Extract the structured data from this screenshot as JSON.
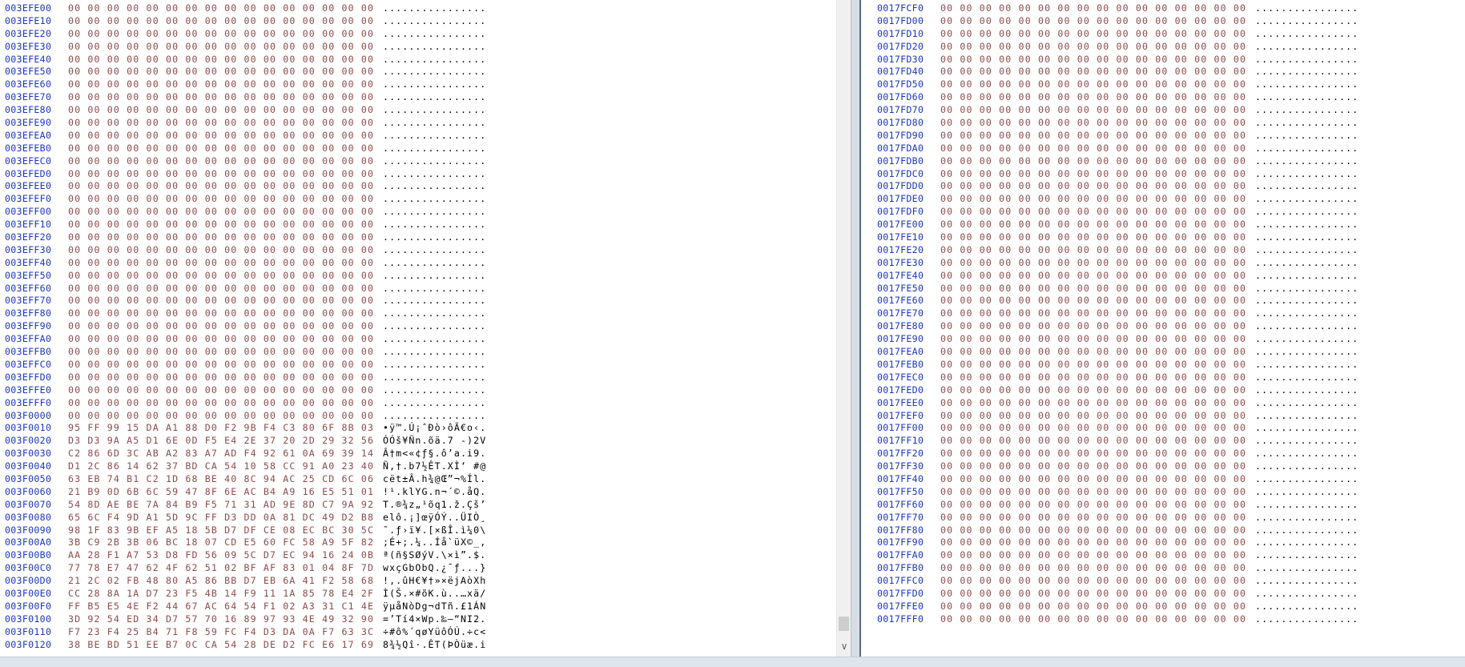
{
  "left_pane": {
    "rows": [
      {
        "offset": "003EFE00",
        "hex": "00 00 00 00 00 00 00 00 00 00 00 00 00 00 00 00",
        "ascii": "................"
      },
      {
        "offset": "003EFE10",
        "hex": "00 00 00 00 00 00 00 00 00 00 00 00 00 00 00 00",
        "ascii": "................"
      },
      {
        "offset": "003EFE20",
        "hex": "00 00 00 00 00 00 00 00 00 00 00 00 00 00 00 00",
        "ascii": "................"
      },
      {
        "offset": "003EFE30",
        "hex": "00 00 00 00 00 00 00 00 00 00 00 00 00 00 00 00",
        "ascii": "................"
      },
      {
        "offset": "003EFE40",
        "hex": "00 00 00 00 00 00 00 00 00 00 00 00 00 00 00 00",
        "ascii": "................"
      },
      {
        "offset": "003EFE50",
        "hex": "00 00 00 00 00 00 00 00 00 00 00 00 00 00 00 00",
        "ascii": "................"
      },
      {
        "offset": "003EFE60",
        "hex": "00 00 00 00 00 00 00 00 00 00 00 00 00 00 00 00",
        "ascii": "................"
      },
      {
        "offset": "003EFE70",
        "hex": "00 00 00 00 00 00 00 00 00 00 00 00 00 00 00 00",
        "ascii": "................"
      },
      {
        "offset": "003EFE80",
        "hex": "00 00 00 00 00 00 00 00 00 00 00 00 00 00 00 00",
        "ascii": "................"
      },
      {
        "offset": "003EFE90",
        "hex": "00 00 00 00 00 00 00 00 00 00 00 00 00 00 00 00",
        "ascii": "................"
      },
      {
        "offset": "003EFEA0",
        "hex": "00 00 00 00 00 00 00 00 00 00 00 00 00 00 00 00",
        "ascii": "................"
      },
      {
        "offset": "003EFEB0",
        "hex": "00 00 00 00 00 00 00 00 00 00 00 00 00 00 00 00",
        "ascii": "................"
      },
      {
        "offset": "003EFEC0",
        "hex": "00 00 00 00 00 00 00 00 00 00 00 00 00 00 00 00",
        "ascii": "................"
      },
      {
        "offset": "003EFED0",
        "hex": "00 00 00 00 00 00 00 00 00 00 00 00 00 00 00 00",
        "ascii": "................"
      },
      {
        "offset": "003EFEE0",
        "hex": "00 00 00 00 00 00 00 00 00 00 00 00 00 00 00 00",
        "ascii": "................"
      },
      {
        "offset": "003EFEF0",
        "hex": "00 00 00 00 00 00 00 00 00 00 00 00 00 00 00 00",
        "ascii": "................"
      },
      {
        "offset": "003EFF00",
        "hex": "00 00 00 00 00 00 00 00 00 00 00 00 00 00 00 00",
        "ascii": "................"
      },
      {
        "offset": "003EFF10",
        "hex": "00 00 00 00 00 00 00 00 00 00 00 00 00 00 00 00",
        "ascii": "................"
      },
      {
        "offset": "003EFF20",
        "hex": "00 00 00 00 00 00 00 00 00 00 00 00 00 00 00 00",
        "ascii": "................"
      },
      {
        "offset": "003EFF30",
        "hex": "00 00 00 00 00 00 00 00 00 00 00 00 00 00 00 00",
        "ascii": "................"
      },
      {
        "offset": "003EFF40",
        "hex": "00 00 00 00 00 00 00 00 00 00 00 00 00 00 00 00",
        "ascii": "................"
      },
      {
        "offset": "003EFF50",
        "hex": "00 00 00 00 00 00 00 00 00 00 00 00 00 00 00 00",
        "ascii": "................"
      },
      {
        "offset": "003EFF60",
        "hex": "00 00 00 00 00 00 00 00 00 00 00 00 00 00 00 00",
        "ascii": "................"
      },
      {
        "offset": "003EFF70",
        "hex": "00 00 00 00 00 00 00 00 00 00 00 00 00 00 00 00",
        "ascii": "................"
      },
      {
        "offset": "003EFF80",
        "hex": "00 00 00 00 00 00 00 00 00 00 00 00 00 00 00 00",
        "ascii": "................"
      },
      {
        "offset": "003EFF90",
        "hex": "00 00 00 00 00 00 00 00 00 00 00 00 00 00 00 00",
        "ascii": "................"
      },
      {
        "offset": "003EFFA0",
        "hex": "00 00 00 00 00 00 00 00 00 00 00 00 00 00 00 00",
        "ascii": "................"
      },
      {
        "offset": "003EFFB0",
        "hex": "00 00 00 00 00 00 00 00 00 00 00 00 00 00 00 00",
        "ascii": "................"
      },
      {
        "offset": "003EFFC0",
        "hex": "00 00 00 00 00 00 00 00 00 00 00 00 00 00 00 00",
        "ascii": "................"
      },
      {
        "offset": "003EFFD0",
        "hex": "00 00 00 00 00 00 00 00 00 00 00 00 00 00 00 00",
        "ascii": "................"
      },
      {
        "offset": "003EFFE0",
        "hex": "00 00 00 00 00 00 00 00 00 00 00 00 00 00 00 00",
        "ascii": "................"
      },
      {
        "offset": "003EFFF0",
        "hex": "00 00 00 00 00 00 00 00 00 00 00 00 00 00 00 00",
        "ascii": "................"
      },
      {
        "offset": "003F0000",
        "hex": "00 00 00 00 00 00 00 00 00 00 00 00 00 00 00 00",
        "ascii": "................"
      },
      {
        "offset": "003F0010",
        "hex": "95 FF 99 15 DA A1 88 D0 F2 9B F4 C3 80 6F 8B 03",
        "ascii": "•ÿ™.Ú¡ˆÐò›ôÃ€o‹."
      },
      {
        "offset": "003F0020",
        "hex": "D3 D3 9A A5 D1 6E 0D F5 E4 2E 37 20 2D 29 32 56",
        "ascii": "ÓÓš¥Ñn.õä.7 -)2V"
      },
      {
        "offset": "003F0030",
        "hex": "C2 86 6D 3C AB A2 83 A7 AD F4 92 61 0A 69 39 14",
        "ascii": "Â†m<«¢ƒ§.ô’a.i9."
      },
      {
        "offset": "003F0040",
        "hex": "D1 2C 86 14 62 37 BD CA 54 10 58 CC 91 A0 23 40",
        "ascii": "Ñ,†.b7½ÊT.XÌ‘ #@"
      },
      {
        "offset": "003F0050",
        "hex": "63 EB 74 B1 C2 1D 68 BE 40 8C 94 AC 25 CD 6C 06",
        "ascii": "cët±Â.h¾@Œ”¬%Íl."
      },
      {
        "offset": "003F0060",
        "hex": "21 B9 0D 6B 6C 59 47 8F 6E AC B4 A9 16 E5 51 01",
        "ascii": "!¹.klYG.n¬´©.åQ."
      },
      {
        "offset": "003F0070",
        "hex": "54 8D AE BE 7A 84 B9 F5 71 31 AD 9E 8D C7 9A 92",
        "ascii": "T.®¾z„¹õq1.ž.Çš’"
      },
      {
        "offset": "003F0080",
        "hex": "65 6C F4 9D A1 5D 9C FF D3 DD 0A 81 DC 49 D2 B8",
        "ascii": "elô.¡]œÿÓÝ..ÜIÒ¸"
      },
      {
        "offset": "003F0090",
        "hex": "98 1F 83 9B EF A5 18 5B D7 DF CE 08 EC BC 30 5C",
        "ascii": "˜.ƒ›ï¥.[×ßÎ.ì¼0\\"
      },
      {
        "offset": "003F00A0",
        "hex": "3B C9 2B 3B 06 BC 18 07 CD E5 60 FC 58 A9 5F 82",
        "ascii": ";É+;.¼..Íå`üX©_‚"
      },
      {
        "offset": "003F00B0",
        "hex": "AA 28 F1 A7 53 D8 FD 56 09 5C D7 EC 94 16 24 0B",
        "ascii": "ª(ñ§SØýV.\\×ì”.$."
      },
      {
        "offset": "003F00C0",
        "hex": "77 78 E7 47 62 4F 62 51 02 BF AF 83 01 04 8F 7D",
        "ascii": "wxçGbObQ.¿¯ƒ...}"
      },
      {
        "offset": "003F00D0",
        "hex": "21 2C 02 FB 48 80 A5 86 BB D7 EB 6A 41 F2 58 68",
        "ascii": "!,.ûH€¥†»×ëjAòXh"
      },
      {
        "offset": "003F00E0",
        "hex": "CC 28 8A 1A D7 23 F5 4B 14 F9 11 1A 85 78 E4 2F",
        "ascii": "Ì(Š.×#õK.ù..…xä/"
      },
      {
        "offset": "003F00F0",
        "hex": "FF B5 E5 4E F2 44 67 AC 64 54 F1 02 A3 31 C1 4E",
        "ascii": "ÿµåNòDg¬dTñ.£1ÁN"
      },
      {
        "offset": "003F0100",
        "hex": "3D 92 54 ED 34 D7 57 70 16 89 97 93 4E 49 32 90",
        "ascii": "=’Tí4×Wp.‰—“NI2."
      },
      {
        "offset": "003F0110",
        "hex": "F7 23 F4 25 B4 71 F8 59 FC F4 D3 DA 0A F7 63 3C",
        "ascii": "÷#ô%´qøYüôÓÚ.÷c<"
      },
      {
        "offset": "003F0120",
        "hex": "38 BE BD 51 EE B7 0C CA 54 28 DE D2 FC E6 17 69",
        "ascii": "8¾½Qî·.ÊT(ÞÒüæ.i"
      }
    ]
  },
  "right_pane": {
    "rows": [
      {
        "offset": "0017FCF0",
        "hex": "00 00 00 00 00 00 00 00 00 00 00 00 00 00 00 00",
        "ascii": "................"
      },
      {
        "offset": "0017FD00",
        "hex": "00 00 00 00 00 00 00 00 00 00 00 00 00 00 00 00",
        "ascii": "................"
      },
      {
        "offset": "0017FD10",
        "hex": "00 00 00 00 00 00 00 00 00 00 00 00 00 00 00 00",
        "ascii": "................"
      },
      {
        "offset": "0017FD20",
        "hex": "00 00 00 00 00 00 00 00 00 00 00 00 00 00 00 00",
        "ascii": "................"
      },
      {
        "offset": "0017FD30",
        "hex": "00 00 00 00 00 00 00 00 00 00 00 00 00 00 00 00",
        "ascii": "................"
      },
      {
        "offset": "0017FD40",
        "hex": "00 00 00 00 00 00 00 00 00 00 00 00 00 00 00 00",
        "ascii": "................"
      },
      {
        "offset": "0017FD50",
        "hex": "00 00 00 00 00 00 00 00 00 00 00 00 00 00 00 00",
        "ascii": "................"
      },
      {
        "offset": "0017FD60",
        "hex": "00 00 00 00 00 00 00 00 00 00 00 00 00 00 00 00",
        "ascii": "................"
      },
      {
        "offset": "0017FD70",
        "hex": "00 00 00 00 00 00 00 00 00 00 00 00 00 00 00 00",
        "ascii": "................"
      },
      {
        "offset": "0017FD80",
        "hex": "00 00 00 00 00 00 00 00 00 00 00 00 00 00 00 00",
        "ascii": "................"
      },
      {
        "offset": "0017FD90",
        "hex": "00 00 00 00 00 00 00 00 00 00 00 00 00 00 00 00",
        "ascii": "................"
      },
      {
        "offset": "0017FDA0",
        "hex": "00 00 00 00 00 00 00 00 00 00 00 00 00 00 00 00",
        "ascii": "................"
      },
      {
        "offset": "0017FDB0",
        "hex": "00 00 00 00 00 00 00 00 00 00 00 00 00 00 00 00",
        "ascii": "................"
      },
      {
        "offset": "0017FDC0",
        "hex": "00 00 00 00 00 00 00 00 00 00 00 00 00 00 00 00",
        "ascii": "................"
      },
      {
        "offset": "0017FDD0",
        "hex": "00 00 00 00 00 00 00 00 00 00 00 00 00 00 00 00",
        "ascii": "................"
      },
      {
        "offset": "0017FDE0",
        "hex": "00 00 00 00 00 00 00 00 00 00 00 00 00 00 00 00",
        "ascii": "................"
      },
      {
        "offset": "0017FDF0",
        "hex": "00 00 00 00 00 00 00 00 00 00 00 00 00 00 00 00",
        "ascii": "................"
      },
      {
        "offset": "0017FE00",
        "hex": "00 00 00 00 00 00 00 00 00 00 00 00 00 00 00 00",
        "ascii": "................"
      },
      {
        "offset": "0017FE10",
        "hex": "00 00 00 00 00 00 00 00 00 00 00 00 00 00 00 00",
        "ascii": "................"
      },
      {
        "offset": "0017FE20",
        "hex": "00 00 00 00 00 00 00 00 00 00 00 00 00 00 00 00",
        "ascii": "................"
      },
      {
        "offset": "0017FE30",
        "hex": "00 00 00 00 00 00 00 00 00 00 00 00 00 00 00 00",
        "ascii": "................"
      },
      {
        "offset": "0017FE40",
        "hex": "00 00 00 00 00 00 00 00 00 00 00 00 00 00 00 00",
        "ascii": "................"
      },
      {
        "offset": "0017FE50",
        "hex": "00 00 00 00 00 00 00 00 00 00 00 00 00 00 00 00",
        "ascii": "................"
      },
      {
        "offset": "0017FE60",
        "hex": "00 00 00 00 00 00 00 00 00 00 00 00 00 00 00 00",
        "ascii": "................"
      },
      {
        "offset": "0017FE70",
        "hex": "00 00 00 00 00 00 00 00 00 00 00 00 00 00 00 00",
        "ascii": "................"
      },
      {
        "offset": "0017FE80",
        "hex": "00 00 00 00 00 00 00 00 00 00 00 00 00 00 00 00",
        "ascii": "................"
      },
      {
        "offset": "0017FE90",
        "hex": "00 00 00 00 00 00 00 00 00 00 00 00 00 00 00 00",
        "ascii": "................"
      },
      {
        "offset": "0017FEA0",
        "hex": "00 00 00 00 00 00 00 00 00 00 00 00 00 00 00 00",
        "ascii": "................"
      },
      {
        "offset": "0017FEB0",
        "hex": "00 00 00 00 00 00 00 00 00 00 00 00 00 00 00 00",
        "ascii": "................"
      },
      {
        "offset": "0017FEC0",
        "hex": "00 00 00 00 00 00 00 00 00 00 00 00 00 00 00 00",
        "ascii": "................"
      },
      {
        "offset": "0017FED0",
        "hex": "00 00 00 00 00 00 00 00 00 00 00 00 00 00 00 00",
        "ascii": "................"
      },
      {
        "offset": "0017FEE0",
        "hex": "00 00 00 00 00 00 00 00 00 00 00 00 00 00 00 00",
        "ascii": "................"
      },
      {
        "offset": "0017FEF0",
        "hex": "00 00 00 00 00 00 00 00 00 00 00 00 00 00 00 00",
        "ascii": "................"
      },
      {
        "offset": "0017FF00",
        "hex": "00 00 00 00 00 00 00 00 00 00 00 00 00 00 00 00",
        "ascii": "................"
      },
      {
        "offset": "0017FF10",
        "hex": "00 00 00 00 00 00 00 00 00 00 00 00 00 00 00 00",
        "ascii": "................"
      },
      {
        "offset": "0017FF20",
        "hex": "00 00 00 00 00 00 00 00 00 00 00 00 00 00 00 00",
        "ascii": "................"
      },
      {
        "offset": "0017FF30",
        "hex": "00 00 00 00 00 00 00 00 00 00 00 00 00 00 00 00",
        "ascii": "................"
      },
      {
        "offset": "0017FF40",
        "hex": "00 00 00 00 00 00 00 00 00 00 00 00 00 00 00 00",
        "ascii": "................"
      },
      {
        "offset": "0017FF50",
        "hex": "00 00 00 00 00 00 00 00 00 00 00 00 00 00 00 00",
        "ascii": "................"
      },
      {
        "offset": "0017FF60",
        "hex": "00 00 00 00 00 00 00 00 00 00 00 00 00 00 00 00",
        "ascii": "................"
      },
      {
        "offset": "0017FF70",
        "hex": "00 00 00 00 00 00 00 00 00 00 00 00 00 00 00 00",
        "ascii": "................"
      },
      {
        "offset": "0017FF80",
        "hex": "00 00 00 00 00 00 00 00 00 00 00 00 00 00 00 00",
        "ascii": "................"
      },
      {
        "offset": "0017FF90",
        "hex": "00 00 00 00 00 00 00 00 00 00 00 00 00 00 00 00",
        "ascii": "................"
      },
      {
        "offset": "0017FFA0",
        "hex": "00 00 00 00 00 00 00 00 00 00 00 00 00 00 00 00",
        "ascii": "................"
      },
      {
        "offset": "0017FFB0",
        "hex": "00 00 00 00 00 00 00 00 00 00 00 00 00 00 00 00",
        "ascii": "................"
      },
      {
        "offset": "0017FFC0",
        "hex": "00 00 00 00 00 00 00 00 00 00 00 00 00 00 00 00",
        "ascii": "................"
      },
      {
        "offset": "0017FFD0",
        "hex": "00 00 00 00 00 00 00 00 00 00 00 00 00 00 00 00",
        "ascii": "................"
      },
      {
        "offset": "0017FFE0",
        "hex": "00 00 00 00 00 00 00 00 00 00 00 00 00 00 00 00",
        "ascii": "................"
      },
      {
        "offset": "0017FFF0",
        "hex": "00 00 00 00 00 00 00 00 00 00 00 00 00 00 00 00",
        "ascii": "................"
      }
    ]
  },
  "colors": {
    "offset": "#1a35c2",
    "hex": "#8c4b4b",
    "ascii": "#000000",
    "splitter": "#d8dde4"
  },
  "icons": {
    "scroll_down": "chevron-down-icon"
  },
  "scroll_down_glyph": "∨"
}
